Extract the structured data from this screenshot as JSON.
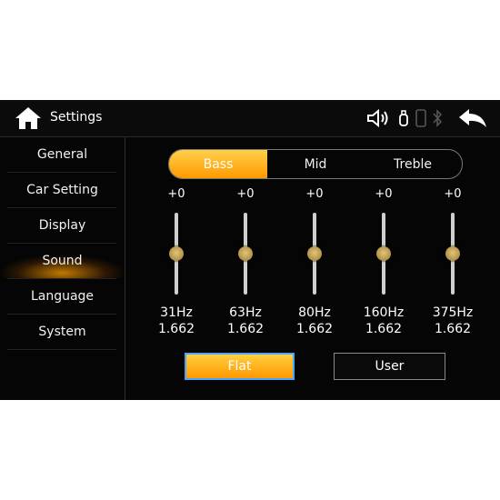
{
  "header": {
    "title": "Settings",
    "icons": [
      "home-icon",
      "volume-icon",
      "usb-icon",
      "phone-icon",
      "bluetooth-icon",
      "back-arrow-icon"
    ]
  },
  "sidebar": {
    "items": [
      {
        "label": "General"
      },
      {
        "label": "Car Setting"
      },
      {
        "label": "Display"
      },
      {
        "label": "Sound",
        "active": true
      },
      {
        "label": "Language"
      },
      {
        "label": "System"
      }
    ]
  },
  "eq": {
    "tabs": [
      {
        "label": "Bass",
        "active": true
      },
      {
        "label": "Mid"
      },
      {
        "label": "Treble"
      }
    ],
    "bands": [
      {
        "gain": "+0",
        "freq": "31Hz",
        "q": "1.662",
        "level": 0.5
      },
      {
        "gain": "+0",
        "freq": "63Hz",
        "q": "1.662",
        "level": 0.5
      },
      {
        "gain": "+0",
        "freq": "80Hz",
        "q": "1.662",
        "level": 0.5
      },
      {
        "gain": "+0",
        "freq": "160Hz",
        "q": "1.662",
        "level": 0.5
      },
      {
        "gain": "+0",
        "freq": "375Hz",
        "q": "1.662",
        "level": 0.5
      }
    ],
    "presets": {
      "flat_label": "Flat",
      "user_label": "User",
      "selected": "Flat"
    }
  },
  "colors": {
    "accent": "#ff9a00",
    "accent_light": "#ffd04a",
    "focus_border": "#4aa3ff",
    "background": "#050505"
  }
}
